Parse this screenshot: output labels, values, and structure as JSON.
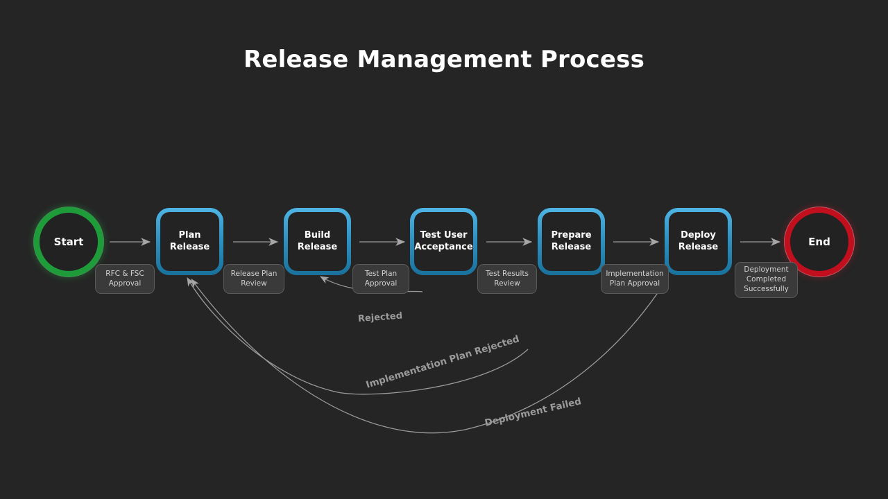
{
  "page": {
    "title": "Release Management Process",
    "background_color": "#252525"
  },
  "colors": {
    "background": "#252525",
    "start_ring": "#1f9c3a",
    "end_ring": "#c20f1e",
    "node_border_light": "#4fb5e4",
    "node_border_dark": "#19719b",
    "node_fill": "#232323",
    "chip_fill": "#3a3a3a",
    "chip_border": "#5a5a5a",
    "edge_line": "#9a9a9a",
    "text_primary": "#ffffff",
    "text_muted": "#d2d2d2"
  },
  "terminators": {
    "start": {
      "label": "Start"
    },
    "end": {
      "label": "End"
    }
  },
  "nodes": [
    {
      "id": "plan",
      "label": "Plan Release"
    },
    {
      "id": "build",
      "label": "Build\nRelease"
    },
    {
      "id": "test",
      "label": "Test User\nAcceptance"
    },
    {
      "id": "prepare",
      "label": "Prepare\nRelease"
    },
    {
      "id": "deploy",
      "label": "Deploy\nRelease"
    }
  ],
  "node_labels": {
    "plan_line1": "Plan Release",
    "build_line1": "Build",
    "build_line2": "Release",
    "test_line1": "Test User",
    "test_line2": "Acceptance",
    "prepare_line1": "Prepare",
    "prepare_line2": "Release",
    "deploy_line1": "Deploy",
    "deploy_line2": "Release"
  },
  "edge_chips": [
    {
      "id": "chip-rfc",
      "line1": "RFC & FSC",
      "line2": "Approval",
      "line3": ""
    },
    {
      "id": "chip-planrev",
      "line1": "Release Plan",
      "line2": "Review",
      "line3": ""
    },
    {
      "id": "chip-testplan",
      "line1": "Test Plan",
      "line2": "Approval",
      "line3": ""
    },
    {
      "id": "chip-testres",
      "line1": "Test Results",
      "line2": "Review",
      "line3": ""
    },
    {
      "id": "chip-implplan",
      "line1": "Implementation",
      "line2": "Plan Approval",
      "line3": ""
    },
    {
      "id": "chip-deployok",
      "line1": "Deployment",
      "line2": "Completed",
      "line3": "Successfully"
    }
  ],
  "curve_labels": {
    "rejected": "Rejected",
    "implementation_plan_rejected": "Implementation Plan Rejected",
    "deployment_failed": "Deployment Failed"
  }
}
